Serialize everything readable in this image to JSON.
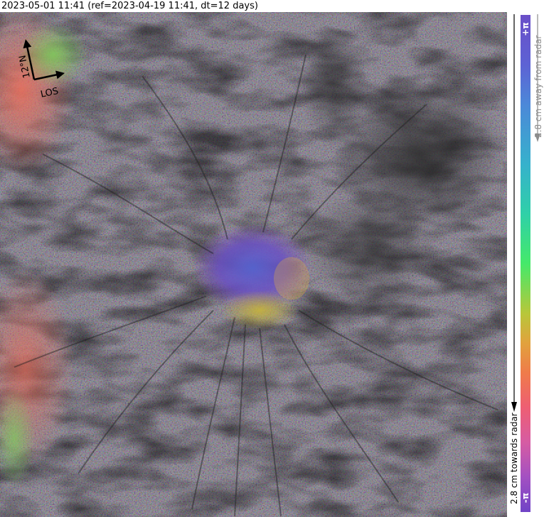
{
  "header": {
    "timestamp_label": "2023-05-01 11:41 (ref=2023-04-19 11:41, dt=12 days)"
  },
  "map": {
    "north_label": "12°N",
    "los_label": "LOS"
  },
  "colorbar": {
    "top_label": "+π",
    "bottom_label": "-π",
    "away_label": "2.8 cm away from radar",
    "towards_label": "2.8 cm towards radar",
    "colors": [
      "#6a4fc8",
      "#4c88d8",
      "#36b1cc",
      "#45e96a",
      "#b7c73a",
      "#ef7b4a",
      "#d65ca3",
      "#7043c6"
    ]
  }
}
